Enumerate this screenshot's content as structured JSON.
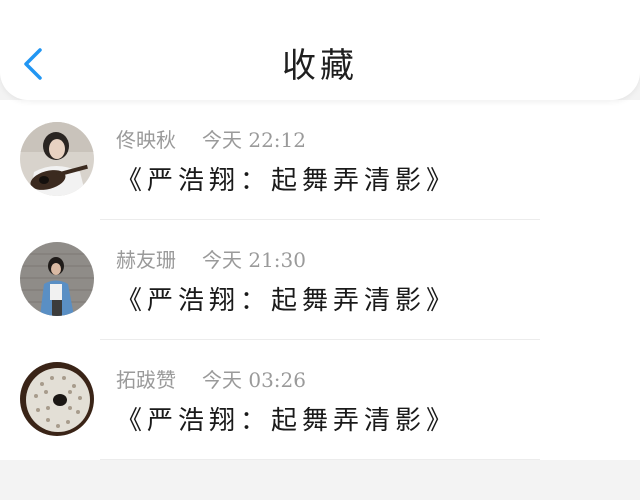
{
  "header": {
    "back_icon": "chevron-left-icon",
    "title": "收藏",
    "accent_color": "#2196F3"
  },
  "favorites": [
    {
      "user": "佟映秋",
      "time": "今天 22:12",
      "content": "《严浩翔：起舞弄清影》",
      "avatar": "person-with-guitar"
    },
    {
      "user": "赫友珊",
      "time": "今天 21:30",
      "content": "《严浩翔：起舞弄清影》",
      "avatar": "person-in-denim"
    },
    {
      "user": "拓跋赞",
      "time": "今天 03:26",
      "content": "《严浩翔：起舞弄清影》",
      "avatar": "sea-urchin-shell"
    }
  ]
}
